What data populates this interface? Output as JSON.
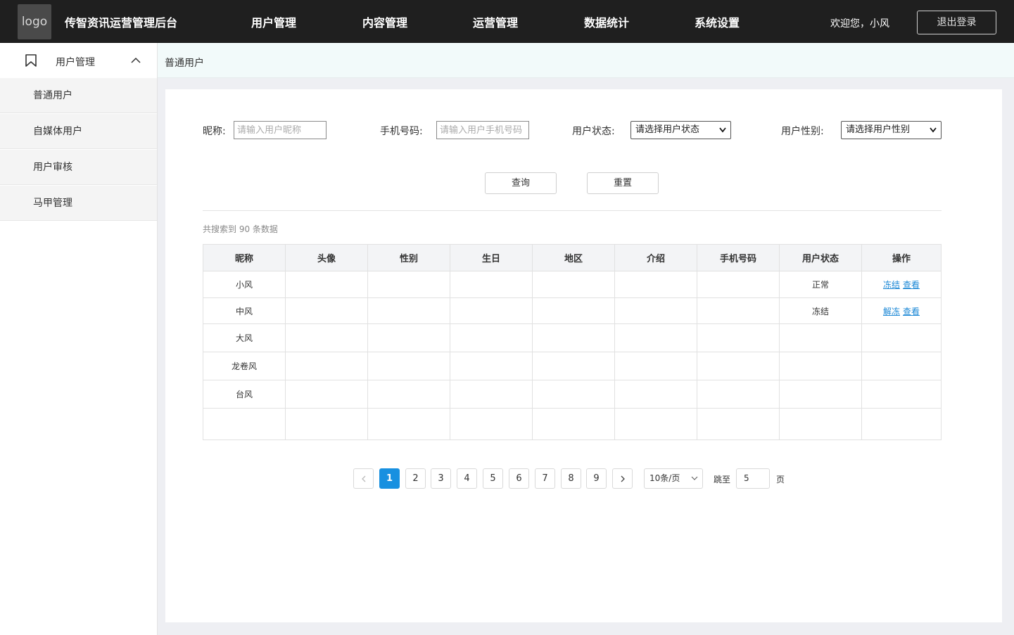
{
  "header": {
    "logo_text": "logo",
    "app_title": "传智资讯运营管理后台",
    "nav": [
      "用户管理",
      "内容管理",
      "运营管理",
      "数据统计",
      "系统设置"
    ],
    "welcome": "欢迎您，小风",
    "logout_label": "退出登录"
  },
  "sidebar": {
    "group_label": "用户管理",
    "items": [
      "普通用户",
      "自媒体用户",
      "用户审核",
      "马甲管理"
    ]
  },
  "breadcrumb": "普通用户",
  "filters": {
    "nickname_label": "昵称:",
    "nickname_placeholder": "请输入用户昵称",
    "phone_label": "手机号码:",
    "phone_placeholder": "请输入用户手机号码",
    "status_label": "用户状态:",
    "status_selected": "请选择用户状态",
    "gender_label": "用户性别:",
    "gender_selected": "请选择用户性别"
  },
  "actions": {
    "query_label": "查询",
    "reset_label": "重置"
  },
  "result_count": "共搜索到 90 条数据",
  "table": {
    "columns": [
      "昵称",
      "头像",
      "性别",
      "生日",
      "地区",
      "介绍",
      "手机号码",
      "用户状态",
      "操作"
    ],
    "rows": [
      {
        "nickname": "小风",
        "status": "正常",
        "op1": "冻结",
        "op2": "查看"
      },
      {
        "nickname": "中风",
        "status": "冻结",
        "op1": "解冻",
        "op2": "查看"
      },
      {
        "nickname": "大风",
        "status": "",
        "op1": "",
        "op2": ""
      },
      {
        "nickname": "龙卷风",
        "status": "",
        "op1": "",
        "op2": ""
      },
      {
        "nickname": "台风",
        "status": "",
        "op1": "",
        "op2": ""
      },
      {
        "nickname": "",
        "status": "",
        "op1": "",
        "op2": ""
      }
    ]
  },
  "pagination": {
    "pages": [
      "1",
      "2",
      "3",
      "4",
      "5",
      "6",
      "7",
      "8",
      "9"
    ],
    "current": "1",
    "page_size": "10条/页",
    "jump_label": "跳至",
    "jump_value": "5",
    "page_suffix": "页"
  },
  "colors": {
    "topbar": "#1f1f1f",
    "accent": "#1890e0",
    "link": "#1c88d6"
  }
}
